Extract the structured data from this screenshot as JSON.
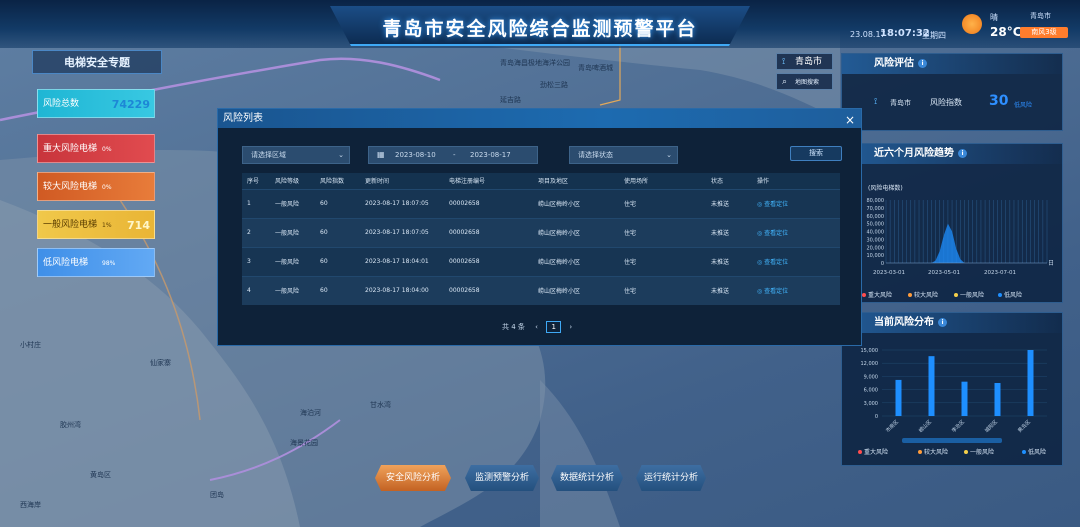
{
  "header": {
    "title": "青岛市安全风险综合监测预警平台",
    "date": "23.08.17",
    "time": "18:07:32",
    "weekday": "星期四",
    "weather_desc": "晴",
    "city": "青岛市",
    "temperature": "28°C",
    "alarm_badge": "南风3级"
  },
  "left_panel": {
    "title": "电梯安全专题",
    "stats": [
      {
        "label": "风险总数",
        "pct": "",
        "value": "74229"
      },
      {
        "label": "重大风险电梯",
        "pct": "0%",
        "value": ""
      },
      {
        "label": "较大风险电梯",
        "pct": "0%",
        "value": ""
      },
      {
        "label": "一般风险电梯",
        "pct": "1%",
        "value": "714"
      },
      {
        "label": "低风险电梯",
        "pct": "98%",
        "value": ""
      }
    ]
  },
  "map": {
    "city_tab": "青岛市",
    "map_search": "地图搜索",
    "labels": [
      "青岛海昌极地海洋公园",
      "青岛啤酒城",
      "劲松三路",
      "延吉路",
      "海泊河",
      "海景花园",
      "仙家寨",
      "小村庄",
      "团岛",
      "胶州湾",
      "甘水湾",
      "黄岛区",
      "西海岸"
    ]
  },
  "right_panel": {
    "risk_eval": {
      "title": "风险评估",
      "city": "青岛市",
      "index_label": "风险指数",
      "index_value": "30",
      "index_suffix": "低风险"
    },
    "trend": {
      "title": "近六个月风险趋势",
      "chart_data": {
        "type": "area",
        "ylabel": "(风险电梯数)",
        "y_ticks": [
          "80,000",
          "70,000",
          "60,000",
          "50,000",
          "40,000",
          "30,000",
          "20,000",
          "10,000",
          "0"
        ],
        "x_ticks": [
          "2023-03-01",
          "2023-05-01",
          "2023-07-01"
        ],
        "x_unit": "日",
        "series": [
          {
            "name": "低风险",
            "color": "#1e8fff",
            "values": [
              0,
              0,
              0,
              0,
              0,
              0,
              0,
              0,
              0,
              0,
              0,
              0,
              3000,
              15000,
              35000,
              50000,
              40000,
              18000,
              5000,
              0,
              0,
              0,
              0,
              0,
              0,
              0,
              0,
              0,
              0,
              0,
              0,
              0,
              0,
              0,
              0,
              0,
              0,
              0,
              0,
              0
            ]
          }
        ],
        "legend": [
          "重大风险",
          "较大风险",
          "一般风险",
          "低风险"
        ],
        "legend_colors": [
          "#ff4d4f",
          "#ff9c3b",
          "#f5d04a",
          "#1e8fff"
        ]
      }
    },
    "dist": {
      "title": "当前风险分布",
      "chart_data": {
        "type": "bar",
        "y_ticks": [
          "15,000",
          "12,000",
          "9,000",
          "6,000",
          "3,000",
          "0"
        ],
        "ylim": [
          0,
          15000
        ],
        "categories": [
          "市南区",
          "崂山区",
          "李沧区",
          "城阳区",
          "黄岛区"
        ],
        "values": [
          8200,
          13600,
          7800,
          7500,
          15000
        ],
        "color": "#1e8fff",
        "legend": [
          "重大风险",
          "较大风险",
          "一般风险",
          "低风险"
        ],
        "legend_colors": [
          "#ff4d4f",
          "#ff9c3b",
          "#f5d04a",
          "#1e8fff"
        ]
      }
    }
  },
  "modal": {
    "title": "风险列表",
    "close": "×",
    "filters": {
      "region_placeholder": "请选择区域",
      "date_start": "2023-08-10",
      "date_sep": "-",
      "date_end": "2023-08-17",
      "status_placeholder": "请选择状态",
      "search_label": "搜索"
    },
    "columns": [
      "序号",
      "风险等级",
      "风险指数",
      "更新时间",
      "电梯注册编号",
      "项目及地区",
      "使用场所",
      "状态",
      "操作"
    ],
    "rows": [
      [
        "1",
        "一般风险",
        "60",
        "2023-08-17 18:07:05",
        "00002658",
        "崂山区梅岭小区",
        "住宅",
        "未推送",
        "查看定位"
      ],
      [
        "2",
        "一般风险",
        "60",
        "2023-08-17 18:07:05",
        "00002658",
        "崂山区梅岭小区",
        "住宅",
        "未推送",
        "查看定位"
      ],
      [
        "3",
        "一般风险",
        "60",
        "2023-08-17 18:04:01",
        "00002658",
        "崂山区梅岭小区",
        "住宅",
        "未推送",
        "查看定位"
      ],
      [
        "4",
        "一般风险",
        "60",
        "2023-08-17 18:04:00",
        "00002658",
        "崂山区梅岭小区",
        "住宅",
        "未推送",
        "查看定位"
      ]
    ],
    "pager": {
      "total": "共 4 条",
      "prev": "‹",
      "page": "1",
      "next": "›"
    }
  },
  "bottom_nav": [
    "安全风险分析",
    "监测预警分析",
    "数据统计分析",
    "运行统计分析"
  ]
}
